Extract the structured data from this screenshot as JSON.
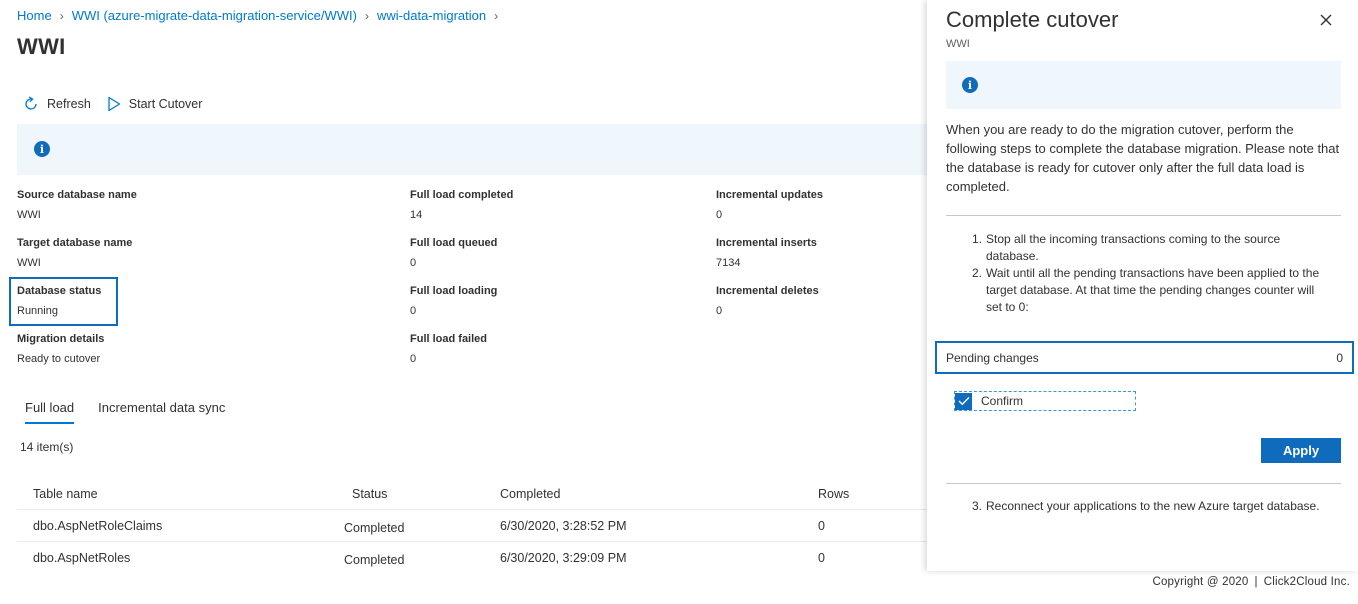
{
  "breadcrumb": {
    "home": "Home",
    "service": "WWI (azure-migrate-data-migration-service/WWI)",
    "migration": "wwi-data-migration"
  },
  "page_title": "WWI",
  "toolbar": {
    "refresh": "Refresh",
    "start_cutover": "Start Cutover"
  },
  "props": {
    "source_db": {
      "label": "Source database name",
      "value": "WWI"
    },
    "target_db": {
      "label": "Target database name",
      "value": "WWI"
    },
    "db_status": {
      "label": "Database status",
      "value": "Running"
    },
    "migration_details": {
      "label": "Migration details",
      "value": "Ready to cutover"
    },
    "full_load_completed": {
      "label": "Full load completed",
      "value": "14"
    },
    "full_load_queued": {
      "label": "Full load queued",
      "value": "0"
    },
    "full_load_loading": {
      "label": "Full load loading",
      "value": "0"
    },
    "full_load_failed": {
      "label": "Full load failed",
      "value": "0"
    },
    "incremental_updates": {
      "label": "Incremental updates",
      "value": "0"
    },
    "incremental_inserts": {
      "label": "Incremental inserts",
      "value": "7134"
    },
    "incremental_deletes": {
      "label": "Incremental deletes",
      "value": "0"
    }
  },
  "tabs": [
    "Full load",
    "Incremental data sync"
  ],
  "item_count": "14 item(s)",
  "table": {
    "columns": [
      "Table name",
      "Status",
      "Completed",
      "Rows"
    ],
    "rows": [
      [
        "dbo.AspNetRoleClaims",
        "Completed",
        "6/30/2020, 3:28:52 PM",
        "0"
      ],
      [
        "dbo.AspNetRoles",
        "Completed",
        "6/30/2020, 3:29:09 PM",
        "0"
      ]
    ]
  },
  "panel": {
    "title": "Complete cutover",
    "subtitle": "WWI",
    "description": "When you are ready to do the migration cutover, perform the following steps to complete the database migration. Please note that the database is ready for cutover only after the full data load is completed.",
    "steps": [
      {
        "num": "1.",
        "text": "Stop all the incoming transactions coming to the source database."
      },
      {
        "num": "2.",
        "text": "Wait until all the pending transactions have been applied to the target database. At that time the pending changes counter will set to 0:"
      }
    ],
    "pending_label": "Pending changes",
    "pending_value": "0",
    "confirm_label": "Confirm",
    "confirm_checked": true,
    "apply_label": "Apply",
    "step3": {
      "num": "3.",
      "text": "Reconnect your applications to the new Azure target database."
    }
  },
  "footer": {
    "copyright": "Copyright @ 2020",
    "separator": "|",
    "company": "Click2Cloud Inc."
  },
  "colors": {
    "accent": "#0078d4",
    "primary_button": "#0f6cbd",
    "info_banner": "#eff6fc"
  },
  "icons": [
    "refresh-icon",
    "play-icon",
    "info-icon",
    "close-icon",
    "checkmark-icon",
    "chevron-right-icon"
  ]
}
